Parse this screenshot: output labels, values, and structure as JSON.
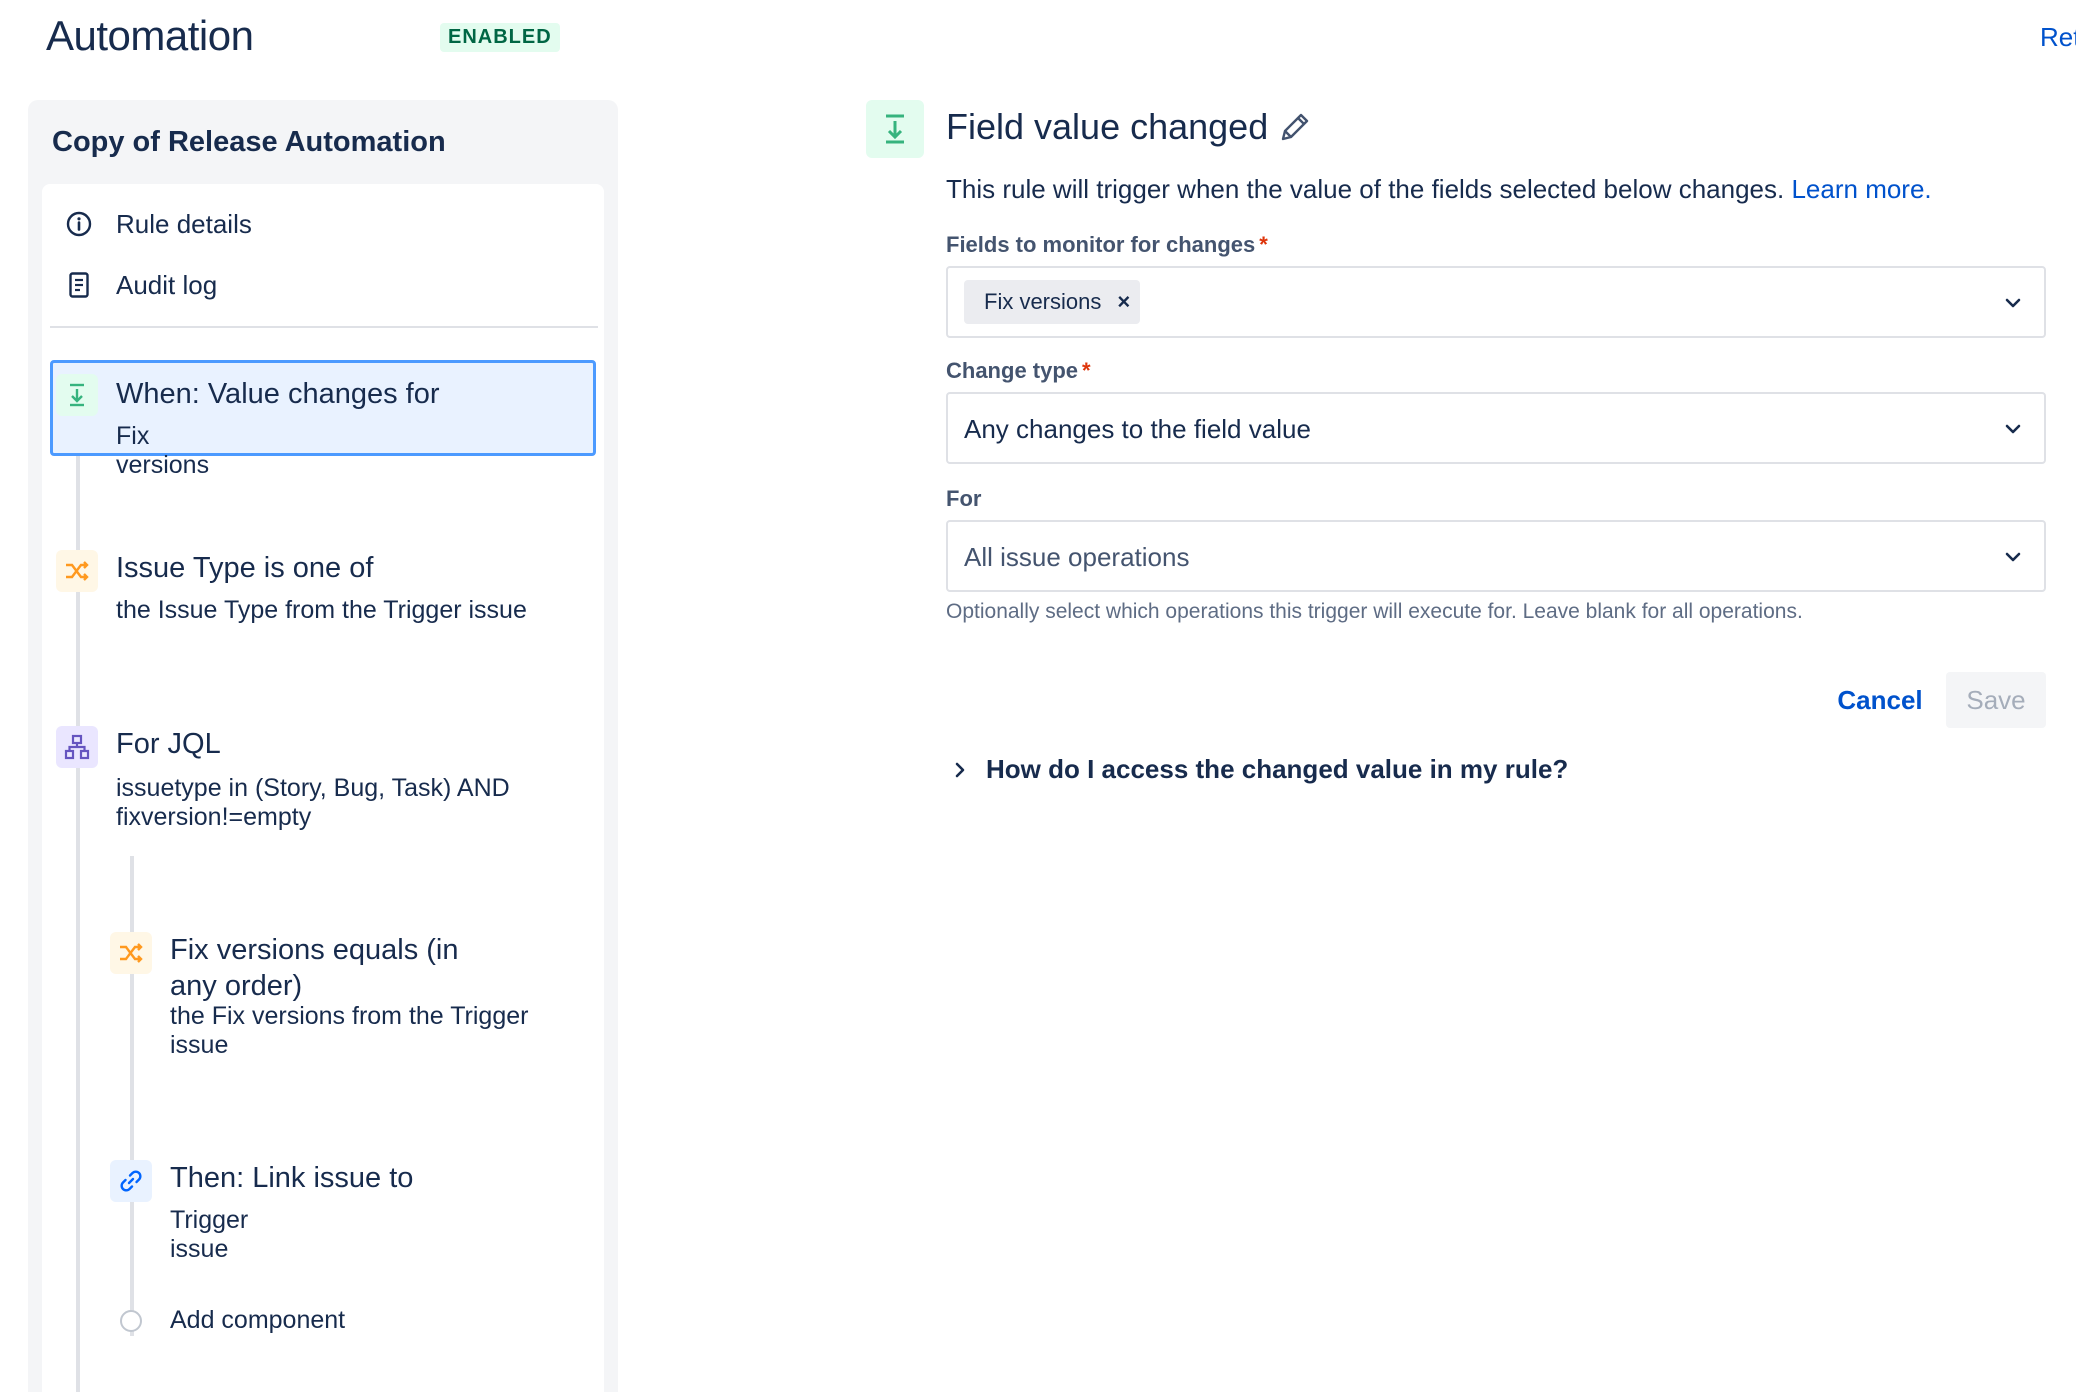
{
  "header": {
    "title": "Automation",
    "status": "ENABLED",
    "right_link": "Ret"
  },
  "sidebar": {
    "rule_name": "Copy of Release Automation",
    "nav": [
      {
        "label": "Rule details",
        "icon": "info-icon"
      },
      {
        "label": "Audit log",
        "icon": "document-icon"
      }
    ],
    "steps": [
      {
        "title": "When: Value changes for",
        "subtitle": "Fix versions",
        "icon": "trigger-icon",
        "color": "#36b37e"
      },
      {
        "title": "Issue Type is one of",
        "subtitle": "the Issue Type from the Trigger issue",
        "icon": "shuffle-icon",
        "color": "#ff991f"
      },
      {
        "title": "For JQL",
        "subtitle": "issuetype in (Story, Bug, Task) AND fixversion!=empty",
        "icon": "branch-icon",
        "color": "#6554c0"
      },
      {
        "title": "Fix versions equals (in any order)",
        "subtitle": "the Fix versions from the Trigger issue",
        "icon": "shuffle-icon",
        "color": "#ff991f"
      },
      {
        "title": "Then: Link issue to",
        "subtitle": "Trigger issue",
        "icon": "link-icon",
        "color": "#0065ff"
      }
    ],
    "add_component": "Add component"
  },
  "panel": {
    "title": "Field value changed",
    "description": "This rule will trigger when the value of the fields selected below changes.",
    "learn_more": "Learn more.",
    "fields_label": "Fields to monitor for changes",
    "fields_tag": "Fix versions",
    "change_type_label": "Change type",
    "change_type_value": "Any changes to the field value",
    "for_label": "For",
    "for_placeholder": "All issue operations",
    "for_help": "Optionally select which operations this trigger will execute for. Leave blank for all operations.",
    "required_mark": "*",
    "tag_remove": "×",
    "cancel": "Cancel",
    "save": "Save",
    "faq": "How do I access the changed value in my rule?"
  },
  "colors": {
    "accent": "#0052cc",
    "selected_bg": "#e9f2ff",
    "selected_border": "#4c9aff",
    "enabled_bg": "#e3fcef",
    "enabled_text": "#006644"
  }
}
